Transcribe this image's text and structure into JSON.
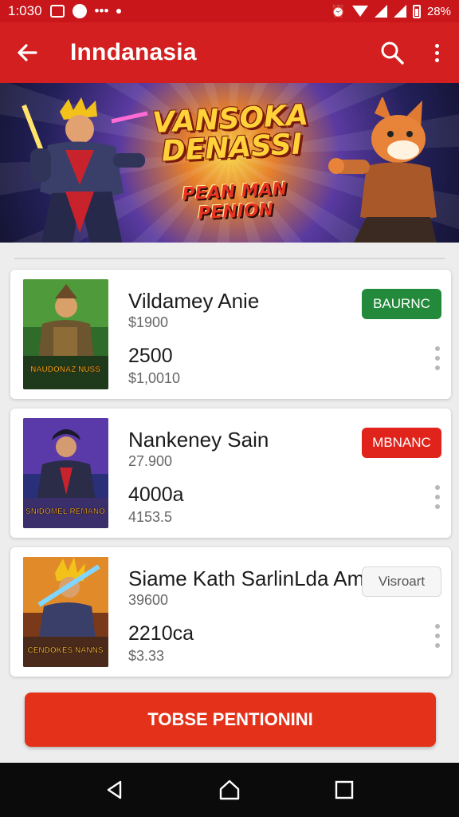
{
  "status_bar": {
    "time": "1:030",
    "battery": "28%"
  },
  "app_bar": {
    "title": "Inndanasia"
  },
  "banner": {
    "title": "VANSOKA DENASSI",
    "subtitle": "PEAN MAN PENION"
  },
  "items": [
    {
      "name": "Vildamey Anie",
      "sub1": "$1900",
      "price": "2500",
      "sub2": "$1,0010",
      "badge": "BAURNC",
      "badge_style": "green",
      "art_text": "NAUDONAZ NUSS"
    },
    {
      "name": "Nankeney Sain",
      "sub1": "27.900",
      "price": "4000a",
      "sub2": "4153.5",
      "badge": "MBNANC",
      "badge_style": "red",
      "art_text": "SNIDOMEL REMANO"
    },
    {
      "name": "Siame Kath SarlinLda Am",
      "sub1": "39600",
      "price": "2210ca",
      "sub2": "$3.33",
      "badge": "Visroart",
      "badge_style": "outline",
      "art_text": "CENDOKES NANNS"
    }
  ],
  "cta": {
    "label": "TOBSE PENTIONINI"
  },
  "colors": {
    "primary": "#d31f1f",
    "status": "#c8161b",
    "green": "#238a3c",
    "cta": "#e3311a"
  },
  "icons": [
    "back-arrow-icon",
    "search-icon",
    "more-vert-icon",
    "nav-back-icon",
    "nav-home-icon",
    "nav-recents-icon"
  ]
}
